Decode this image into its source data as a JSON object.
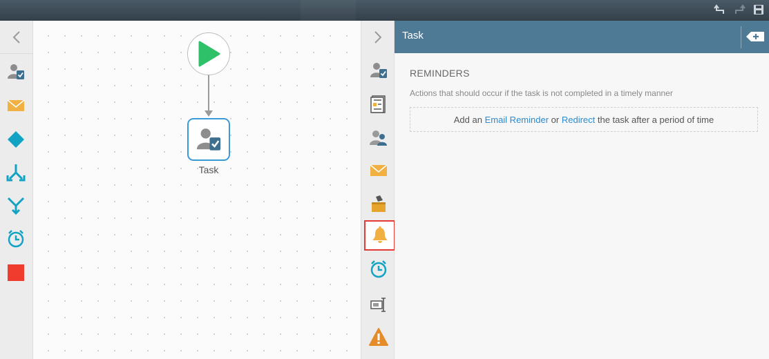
{
  "colors": {
    "topbar": "#3d4a55",
    "panel_header": "#4f7a96",
    "task_node_border": "#3a9ad9",
    "link": "#2a8bd2",
    "selected_outline": "#e53935"
  },
  "topbar": {
    "icons": [
      "undo-icon",
      "redo-icon",
      "save-icon"
    ]
  },
  "left_toolbox": {
    "tools": [
      "user-task-icon",
      "email-icon",
      "decision-icon",
      "split-icon",
      "merge-icon",
      "timer-icon",
      "end-icon"
    ]
  },
  "canvas": {
    "start_node": "start-icon",
    "task_node": {
      "label": "Task",
      "icon": "user-task-icon"
    }
  },
  "property_tools": {
    "tools": [
      "assignment-icon",
      "form-icon",
      "participants-icon",
      "email-icon",
      "actions-icon",
      "reminder-bell-icon",
      "timer-icon",
      "variables-icon",
      "warning-icon"
    ],
    "selected": "reminder-bell-icon"
  },
  "panel": {
    "title": "Task",
    "section_title": "REMINDERS",
    "section_desc": "Actions that should occur if the task is not completed in a timely manner",
    "dropzone": {
      "prefix": "Add an ",
      "link1": "Email Reminder",
      "middle": " or ",
      "link2": "Redirect",
      "suffix": " the task after a period of time"
    }
  }
}
